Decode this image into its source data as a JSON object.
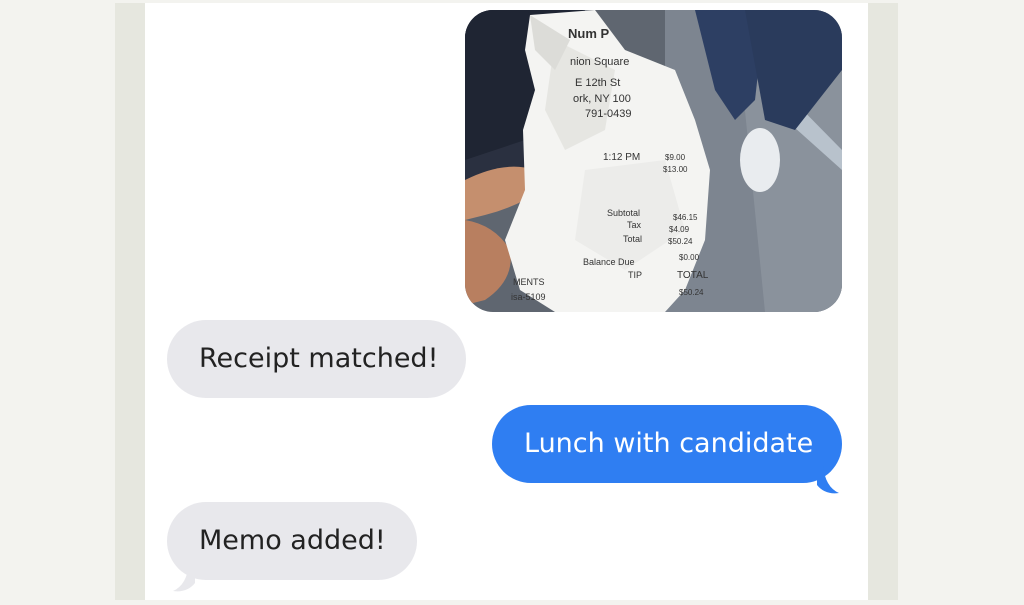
{
  "messages": [
    {
      "type": "received",
      "text": "Receipt matched!"
    },
    {
      "type": "sent",
      "text": "Lunch with candidate"
    },
    {
      "type": "received",
      "text": "Memo added!"
    }
  ],
  "photo": {
    "receipt_lines": [
      "Num P",
      "nion Square",
      "E 12th St",
      "ork, NY 100",
      "791-0439",
      "1:12 PM",
      "Subtotal",
      "Tax",
      "Total",
      "Balance Due",
      "TIP",
      "TOTAL",
      "$9.00",
      "$13.00",
      "$46.15",
      "$4.09",
      "$50.24",
      "$0.00",
      "$50.24",
      "MENTS",
      "isa-5109"
    ]
  },
  "colors": {
    "sent_bubble": "#2f7ef2",
    "received_bubble": "#e8e8ec",
    "background": "#f3f3ef"
  }
}
